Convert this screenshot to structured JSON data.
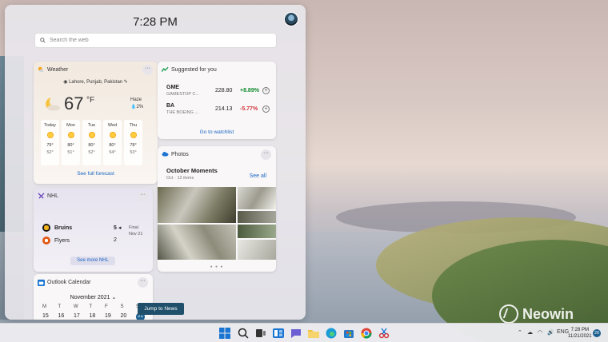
{
  "panel": {
    "clock": "7:28 PM",
    "search_placeholder": "Search the web"
  },
  "weather": {
    "title": "Weather",
    "location": "Lahore, Punjab, Pakistan",
    "temperature": "67",
    "unit": "°F",
    "condition": "Haze",
    "precip": "2%",
    "days": [
      {
        "name": "Today",
        "hi": "79°",
        "lo": "52°"
      },
      {
        "name": "Mon",
        "hi": "80°",
        "lo": "51°"
      },
      {
        "name": "Tue",
        "hi": "80°",
        "lo": "52°"
      },
      {
        "name": "Wed",
        "hi": "80°",
        "lo": "54°"
      },
      {
        "name": "Thu",
        "hi": "78°",
        "lo": "53°"
      }
    ],
    "link": "See full forecast"
  },
  "stocks": {
    "title": "Suggested for you",
    "items": [
      {
        "symbol": "GME",
        "name": "GAMESTOP C...",
        "price": "228.80",
        "change": "+8.89%",
        "direction": "up"
      },
      {
        "symbol": "BA",
        "name": "THE BOEING ...",
        "price": "214.13",
        "change": "-5.77%",
        "direction": "down"
      }
    ],
    "link": "Go to watchlist"
  },
  "photos": {
    "title": "Photos",
    "heading": "October Moments",
    "sub": "Oct · 12 items",
    "see_all": "See all"
  },
  "nhl": {
    "title": "NHL",
    "teams": [
      {
        "name": "Bruins",
        "score": "5",
        "color": "#f2b21b"
      },
      {
        "name": "Flyers",
        "score": "2",
        "color": "#e25a17"
      }
    ],
    "status": "Final",
    "date": "Nov 21",
    "link": "See more NHL"
  },
  "calendar": {
    "title": "Outlook Calendar",
    "month": "November 2021",
    "weekdays": [
      "M",
      "T",
      "W",
      "T",
      "F",
      "S",
      "S"
    ],
    "dates": [
      "15",
      "16",
      "17",
      "18",
      "19",
      "20",
      "21"
    ]
  },
  "tooltip": "Jump to News",
  "watermark": "Neowin",
  "taskbar": {
    "time": "7:28 PM",
    "date": "11/21/2021",
    "notifications": "20",
    "lang": "ENG"
  }
}
